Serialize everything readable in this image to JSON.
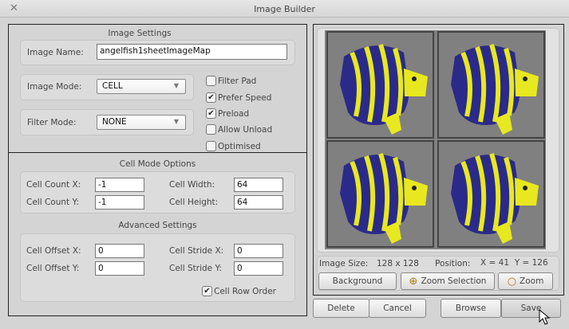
{
  "window": {
    "title": "Image Builder",
    "close_icon": "close-icon"
  },
  "image_settings": {
    "title": "Image Settings",
    "name_label": "Image Name:",
    "name_value": "angelfish1sheetImageMap",
    "mode_label": "Image Mode:",
    "mode_value": "CELL",
    "filter_label": "Filter Mode:",
    "filter_value": "NONE",
    "checkboxes": [
      {
        "label": "Filter Pad",
        "checked": false
      },
      {
        "label": "Prefer Speed",
        "checked": true
      },
      {
        "label": "Preload",
        "checked": true
      },
      {
        "label": "Allow Unload",
        "checked": false
      },
      {
        "label": "Optimised",
        "checked": false
      }
    ]
  },
  "cell_mode": {
    "title": "Cell Mode Options",
    "count_x_label": "Cell Count X:",
    "count_x": "-1",
    "count_y_label": "Cell Count Y:",
    "count_y": "-1",
    "width_label": "Cell Width:",
    "width": "64",
    "height_label": "Cell Height:",
    "height": "64"
  },
  "advanced": {
    "title": "Advanced Settings",
    "offset_x_label": "Cell Offset X:",
    "offset_x": "0",
    "offset_y_label": "Cell Offset Y:",
    "offset_y": "0",
    "stride_x_label": "Cell Stride X:",
    "stride_x": "0",
    "stride_y_label": "Cell Stride Y:",
    "stride_y": "0",
    "row_order_label": "Cell Row Order",
    "row_order": true
  },
  "preview": {
    "size_label": "Image Size:",
    "size_value": "128 x 128",
    "position_label": "Position:",
    "position_value": "X = 41  Y = 126",
    "background_btn": "Background",
    "zoom_selection_btn": "Zoom Selection",
    "zoom_btn": "Zoom"
  },
  "footer": {
    "delete": "Delete",
    "cancel": "Cancel",
    "browse": "Browse",
    "save": "Save"
  }
}
